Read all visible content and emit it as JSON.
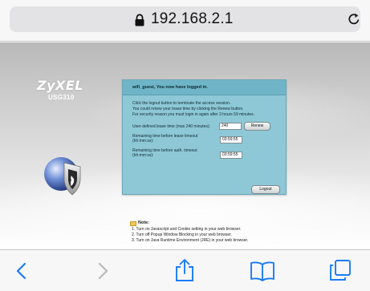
{
  "browser": {
    "url": "192.168.2.1"
  },
  "branding": {
    "logo": "ZyXEL",
    "model": "USG310"
  },
  "login_panel": {
    "title": "wifi_guest, You now have logged in.",
    "messages": [
      "Click the logout button to terminate the access session.",
      "You could renew your lease time by clicking the Renew button.",
      "For security reason you must login in again after 3 hours 59 minutes."
    ],
    "lease_label": "User-defined lease time (max 240 minutes):",
    "lease_value": "240",
    "renew_label": "Renew",
    "lease_timeout_label_1": "Remaining time before lease timeout",
    "lease_timeout_label_2": "(hh:mm:ss):",
    "lease_timeout_value": "03:59:55",
    "auth_timeout_label_1": "Remaining time before auth. timeout",
    "auth_timeout_label_2": "(hh:mm:ss):",
    "auth_timeout_value": "03:59:55",
    "logout_label": "Logout"
  },
  "notes": {
    "title": "Note:",
    "items": [
      "1. Turn on Javascript and Cookie setting in your web browser.",
      "2. Turn off Popup Window Blocking in your web browser.",
      "3. Turn on Java Runtime Environment (JRE) in your web browser."
    ]
  },
  "icons": {
    "lock": "lock-icon",
    "reload": "reload-icon",
    "back": "back-chevron-icon",
    "forward": "forward-chevron-icon",
    "share": "share-icon",
    "bookmarks": "bookmarks-book-icon",
    "tabs": "tabs-icon",
    "globe": "globe-shield-icon"
  },
  "colors": {
    "accent": "#1a7cf5",
    "panel": "#8ec8d6",
    "panel_header": "#6fb5c7"
  }
}
